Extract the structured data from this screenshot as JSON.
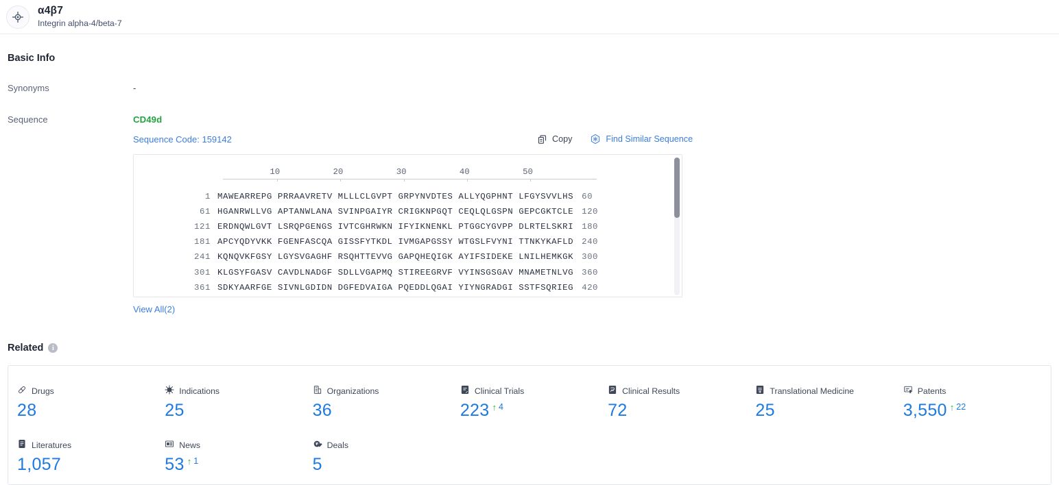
{
  "header": {
    "icon": "target-icon",
    "title": "α4β7",
    "subtitle": "Integrin alpha-4/beta-7"
  },
  "basic_info": {
    "title": "Basic Info",
    "rows": [
      {
        "label": "Synonyms",
        "value": "-"
      },
      {
        "label": "Sequence",
        "value": ""
      }
    ],
    "sequence": {
      "name": "CD49d",
      "code_label": "Sequence Code: 159142",
      "actions": [
        {
          "label": "Copy",
          "icon": "copy-icon"
        },
        {
          "label": "Find Similar Sequence",
          "icon": "molecule-hex-icon"
        }
      ],
      "ruler": [
        "10",
        "20",
        "30",
        "40",
        "50"
      ],
      "rows": [
        {
          "start": "1",
          "chunks": "MAWEARREPG PRRAAVRETV MLLLCLGVPT GRPYNVDTES ALLYQGPHNT LFGYSVVLHS",
          "end": "60"
        },
        {
          "start": "61",
          "chunks": "HGANRWLLVG APTANWLANA SVINPGAIYR CRIGKNPGQT CEQLQLGSPN GEPCGKTCLE",
          "end": "120"
        },
        {
          "start": "121",
          "chunks": "ERDNQWLGVT LSRQPGENGS IVTCGHRWKN IFYIKNENKL PTGGCYGVPP DLRTELSKRI",
          "end": "180"
        },
        {
          "start": "181",
          "chunks": "APCYQDYVKK FGENFASCQA GISSFYTKDL IVMGAPGSSY WTGSLFVYNI TTNKYKAFLD",
          "end": "240"
        },
        {
          "start": "241",
          "chunks": "KQNQVKFGSY LGYSVGAGHF RSQHTTEVVG GAPQHEQIGK AYIFSIDEKE LNILHEMKGK",
          "end": "300"
        },
        {
          "start": "301",
          "chunks": "KLGSYFGASV CAVDLNADGF SDLLVGAPMQ STIREEGRVF VYINSGSGAV MNAMETNLVG",
          "end": "360"
        },
        {
          "start": "361",
          "chunks": "SDKYAARFGE SIVNLGDIDN DGFEDVAIGA PQEDDLQGAI YIYNGRADGI SSTFSQRIEG",
          "end": "420"
        }
      ],
      "view_all": "View All(2)"
    }
  },
  "related": {
    "title": "Related",
    "info_icon": "info-icon",
    "stats": [
      {
        "label": "Drugs",
        "icon": "pill-icon",
        "value": "28"
      },
      {
        "label": "Indications",
        "icon": "virus-icon",
        "value": "25"
      },
      {
        "label": "Organizations",
        "icon": "building-icon",
        "value": "36"
      },
      {
        "label": "Clinical Trials",
        "icon": "trial-doc-icon",
        "value": "223",
        "delta": "4",
        "delta_dir": "up"
      },
      {
        "label": "Clinical Results",
        "icon": "results-doc-icon",
        "value": "72"
      },
      {
        "label": "Translational Medicine",
        "icon": "translational-icon",
        "value": "25"
      },
      {
        "label": "Patents",
        "icon": "patent-icon",
        "value": "3,550",
        "delta": "22",
        "delta_dir": "up"
      },
      {
        "label": "Literatures",
        "icon": "literature-icon",
        "value": "1,057"
      },
      {
        "label": "News",
        "icon": "news-icon",
        "value": "53",
        "delta": "1",
        "delta_dir": "up"
      },
      {
        "label": "Deals",
        "icon": "deals-icon",
        "value": "5"
      }
    ]
  },
  "colors": {
    "accent_blue": "#1e7ae0",
    "link_blue": "#3b7ddd",
    "green": "#22a33f",
    "delta_green": "#2eae3a",
    "text_dark": "#1f2533"
  }
}
